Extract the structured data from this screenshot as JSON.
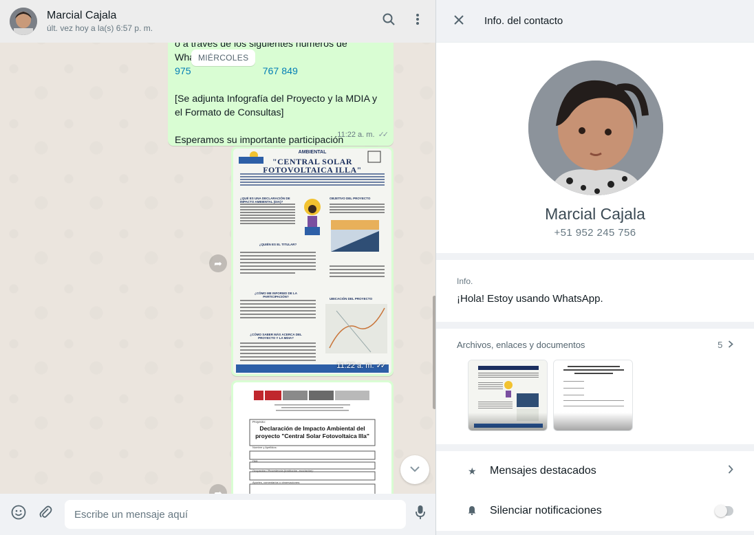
{
  "chat": {
    "contact_name": "Marcial Cajala",
    "last_seen": "últ. vez hoy a la(s) 6:57 p. m.",
    "day_separator": "MIÉRCOLES",
    "text_message": {
      "line_numbers_prefix": "o a través de los siguientes números de WhatsApp:",
      "phone_a": "975",
      "phone_b": "767 849",
      "paragraph_2": "[Se adjunta Infografía del Proyecto y la MDIA y el Formato de Consultas]",
      "paragraph_3": "Esperamos su importante participación",
      "time": "11:22 a. m."
    },
    "image_message": {
      "title_line1": "AMBIENTAL",
      "title_line2": "\"CENTRAL SOLAR",
      "title_line3": "FOTOVOLTAICA ILLA\"",
      "section_1": "¿QUÉ ES UNA DECLARACIÓN DE IMPACTO AMBIENTAL (DIA)?",
      "section_2": "OBJETIVO DEL PROYECTO",
      "section_3": "¿QUIÉN ES EL TITULAR?",
      "section_4": "UBICACIÓN DEL PROYECTO",
      "section_5": "¿CÓMO ME INFORMO DE LA PARTICIPACIÓN?",
      "section_6": "¿CÓMO SABER MÁS ACERCA DEL PROYECTO Y LA MDIA?",
      "time": "11:22 a. m."
    },
    "doc_message": {
      "form_label": "Proyecto:",
      "form_title": "Declaración de Impacto Ambiental del proyecto \"Central Solar Fotovoltaica Illa\"",
      "field_1": "Nombre y Apellidos:",
      "field_2": "DNI:",
      "field_3": "Ocupación / Procedencia (Institución, asociación):",
      "field_4": "Aportes, comentarios u observaciones:"
    },
    "compose_placeholder": "Escribe un mensaje aquí"
  },
  "info": {
    "header_title": "Info. del contacto",
    "name": "Marcial Cajala",
    "phone": "+51 952 245 756",
    "about_label": "Info.",
    "about_text": "¡Hola! Estoy usando WhatsApp.",
    "media_label": "Archivos, enlaces y documentos",
    "media_count": "5",
    "starred_label": "Mensajes destacados",
    "mute_label": "Silenciar notificaciones"
  },
  "colors": {
    "bubble_out": "#d9fdd3",
    "link": "#027eb5",
    "panel_bg": "#f0f2f5"
  },
  "icons": [
    "search-icon",
    "menu-icon",
    "close-icon",
    "emoji-icon",
    "attach-icon",
    "mic-icon",
    "forward-icon",
    "chevron-down-icon",
    "chevron-right-icon",
    "star-icon",
    "bell-icon"
  ]
}
